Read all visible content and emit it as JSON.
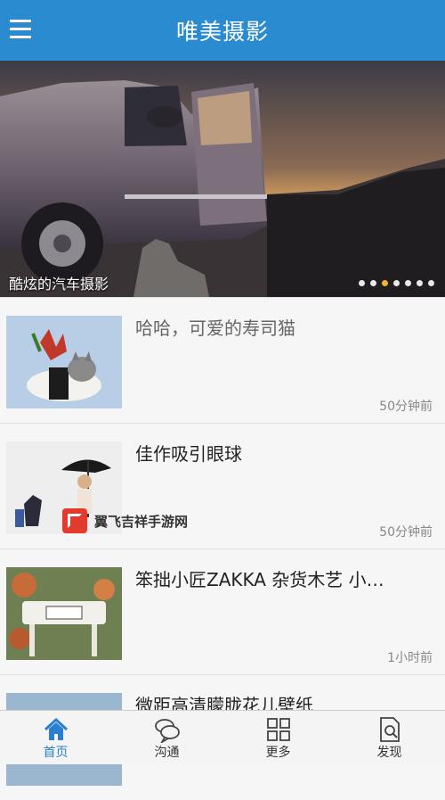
{
  "header": {
    "title": "唯美摄影",
    "menu_icon": "hamburger-menu-icon"
  },
  "banner": {
    "caption": "酷炫的汽车摄影",
    "slide_count": 7,
    "active_slide": 3
  },
  "articles": [
    {
      "title": "哈哈，可爱的寿司猫",
      "time": "50分钟前",
      "read": true
    },
    {
      "title": "佳作吸引眼球",
      "time": "50分钟前",
      "read": false
    },
    {
      "title": "笨拙小匠ZAKKA 杂货木艺 小…",
      "time": "1小时前",
      "read": false
    },
    {
      "title": "微距高清朦胧花儿壁纸",
      "time": "",
      "read": false
    }
  ],
  "watermark": {
    "text": "翼飞吉祥手游网"
  },
  "tabbar": {
    "tabs": [
      {
        "label": "首页",
        "icon": "home-icon",
        "active": true
      },
      {
        "label": "沟通",
        "icon": "chat-bubbles-icon",
        "active": false
      },
      {
        "label": "更多",
        "icon": "grid-icon",
        "active": false
      },
      {
        "label": "发现",
        "icon": "search-document-icon",
        "active": false
      }
    ]
  },
  "colors": {
    "header": "#2a8bd1",
    "active_tab": "#2a7fcf",
    "active_dot": "#f0b32a"
  }
}
